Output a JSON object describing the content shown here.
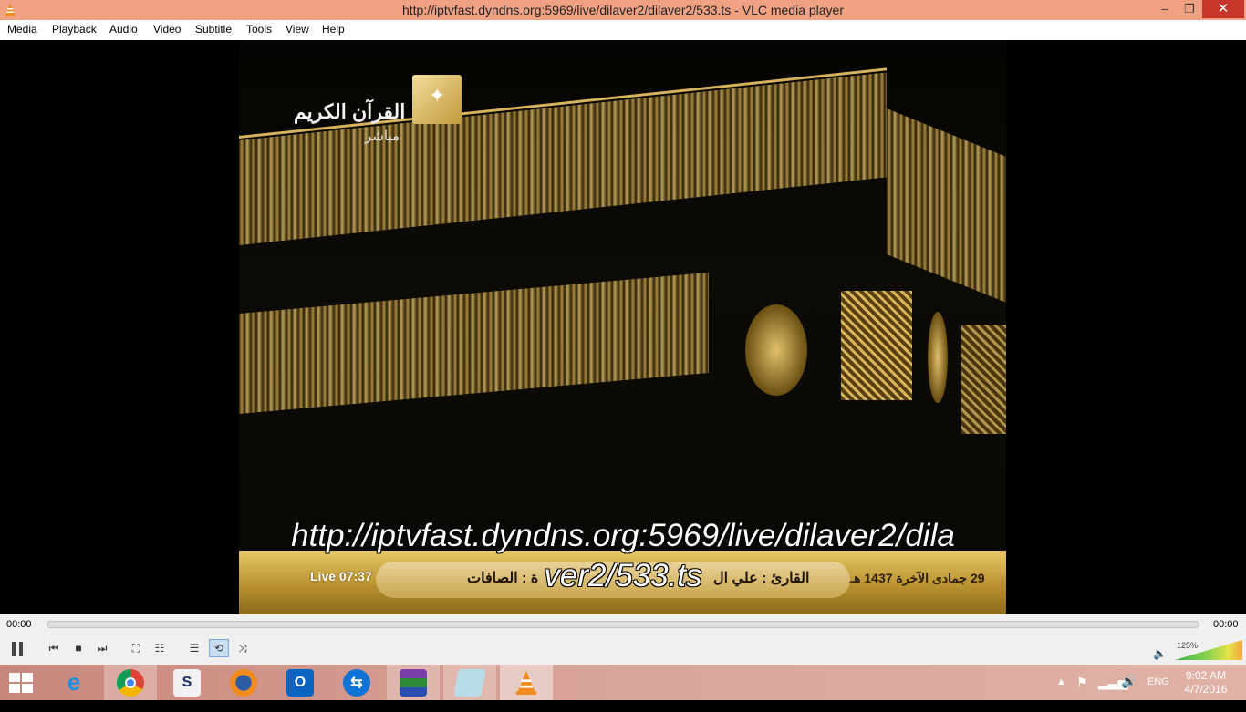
{
  "window": {
    "title": "http://iptvfast.dyndns.org:5969/live/dilaver2/dilaver2/533.ts - VLC media player",
    "minimize": "–",
    "maximize": "❐",
    "close": "✕"
  },
  "menu": [
    "Media",
    "Playback",
    "Audio",
    "Video",
    "Subtitle",
    "Tools",
    "View",
    "Help"
  ],
  "video": {
    "channel_name": "القرآن الكريم",
    "channel_status": "مباشر",
    "ticker_live": "Live 07:37",
    "ticker_reciter": "القارئ : علي ال",
    "ticker_surah": "ة : الصافات",
    "ticker_date": "29 جمادى الآخرة 1437 هـ",
    "osd_line1": "http://iptvfast.dyndns.org:5969/live/dilaver2/dila",
    "osd_line2": "ver2/533.ts"
  },
  "player": {
    "elapsed": "00:00",
    "total": "00:00",
    "volume_percent": "125%",
    "volume_level": 1.25
  },
  "taskbar": {
    "apps": [
      "internet-explorer",
      "chrome",
      "jumper",
      "firefox",
      "outlook",
      "teamviewer",
      "winrar",
      "notepad",
      "vlc"
    ],
    "language": "ENG",
    "time": "9:02 AM",
    "date": "4/7/2016"
  }
}
